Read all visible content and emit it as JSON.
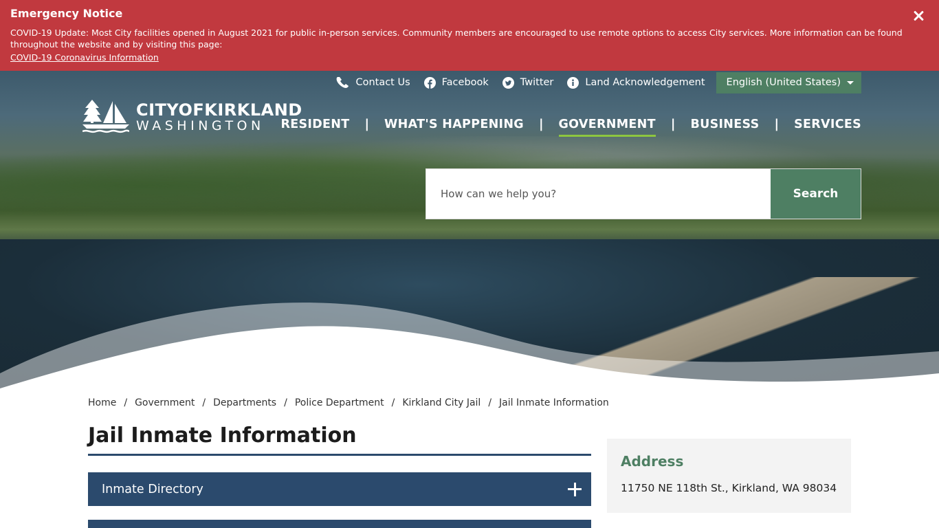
{
  "alert": {
    "title": "Emergency Notice",
    "text": "COVID-19 Update: Most City facilities opened in August 2021 for public in-person services. Community members are encouraged to use remote options to access City services. More information can be found throughout the website and by visiting this page:",
    "link": "COVID-19 Coronavirus Information"
  },
  "utility": {
    "contact": "Contact Us",
    "facebook": "Facebook",
    "twitter": "Twitter",
    "land": "Land Acknowledgement",
    "language": "English (United States)"
  },
  "logo": {
    "line1": "CITYOFKIRKLAND",
    "line2": "WASHINGTON"
  },
  "nav": {
    "resident": "RESIDENT",
    "happening": "WHAT'S HAPPENING",
    "government": "GOVERNMENT",
    "business": "BUSINESS",
    "services": "SERVICES",
    "separator": "|"
  },
  "search": {
    "placeholder": "How can we help you?",
    "button": "Search"
  },
  "breadcrumb": [
    "Home",
    "Government",
    "Departments",
    "Police Department",
    "Kirkland City Jail",
    "Jail Inmate Information"
  ],
  "breadcrumb_separator": "/",
  "page": {
    "title": "Jail Inmate Information"
  },
  "accordion": {
    "item1": "Inmate Directory"
  },
  "sidebar": {
    "heading": "Address",
    "address": "11750 NE 118th St., Kirkland, WA  98034"
  },
  "colors": {
    "alert": "#c1393f",
    "navy": "#2b4a6d",
    "green": "#4e7f63",
    "nav_active": "#8dc63f"
  }
}
